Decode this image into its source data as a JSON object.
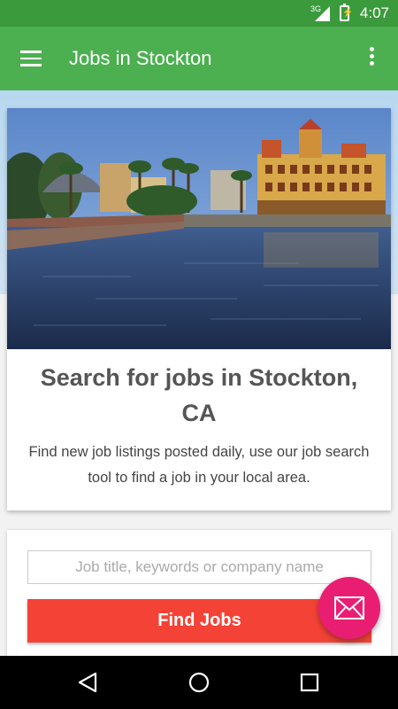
{
  "status_bar": {
    "network": "3G",
    "time": "4:07"
  },
  "app_bar": {
    "title": "Jobs in Stockton",
    "menu_icon": "hamburger-menu-icon",
    "overflow_icon": "more-vert-icon"
  },
  "hero": {
    "title": "Search for jobs in Stockton, CA",
    "description": "Find new job listings posted daily, use our job search tool to find a job in your local area."
  },
  "search": {
    "placeholder": "Job title, keywords or company name",
    "value": "",
    "button_label": "Find Jobs"
  },
  "fab": {
    "icon": "email-icon"
  },
  "nav": {
    "back_icon": "back-icon",
    "home_icon": "home-icon",
    "recents_icon": "recents-icon"
  },
  "colors": {
    "primary": "#4caf50",
    "primary_dark": "#3a9a3c",
    "button": "#f44336",
    "fab": "#e91e73"
  }
}
